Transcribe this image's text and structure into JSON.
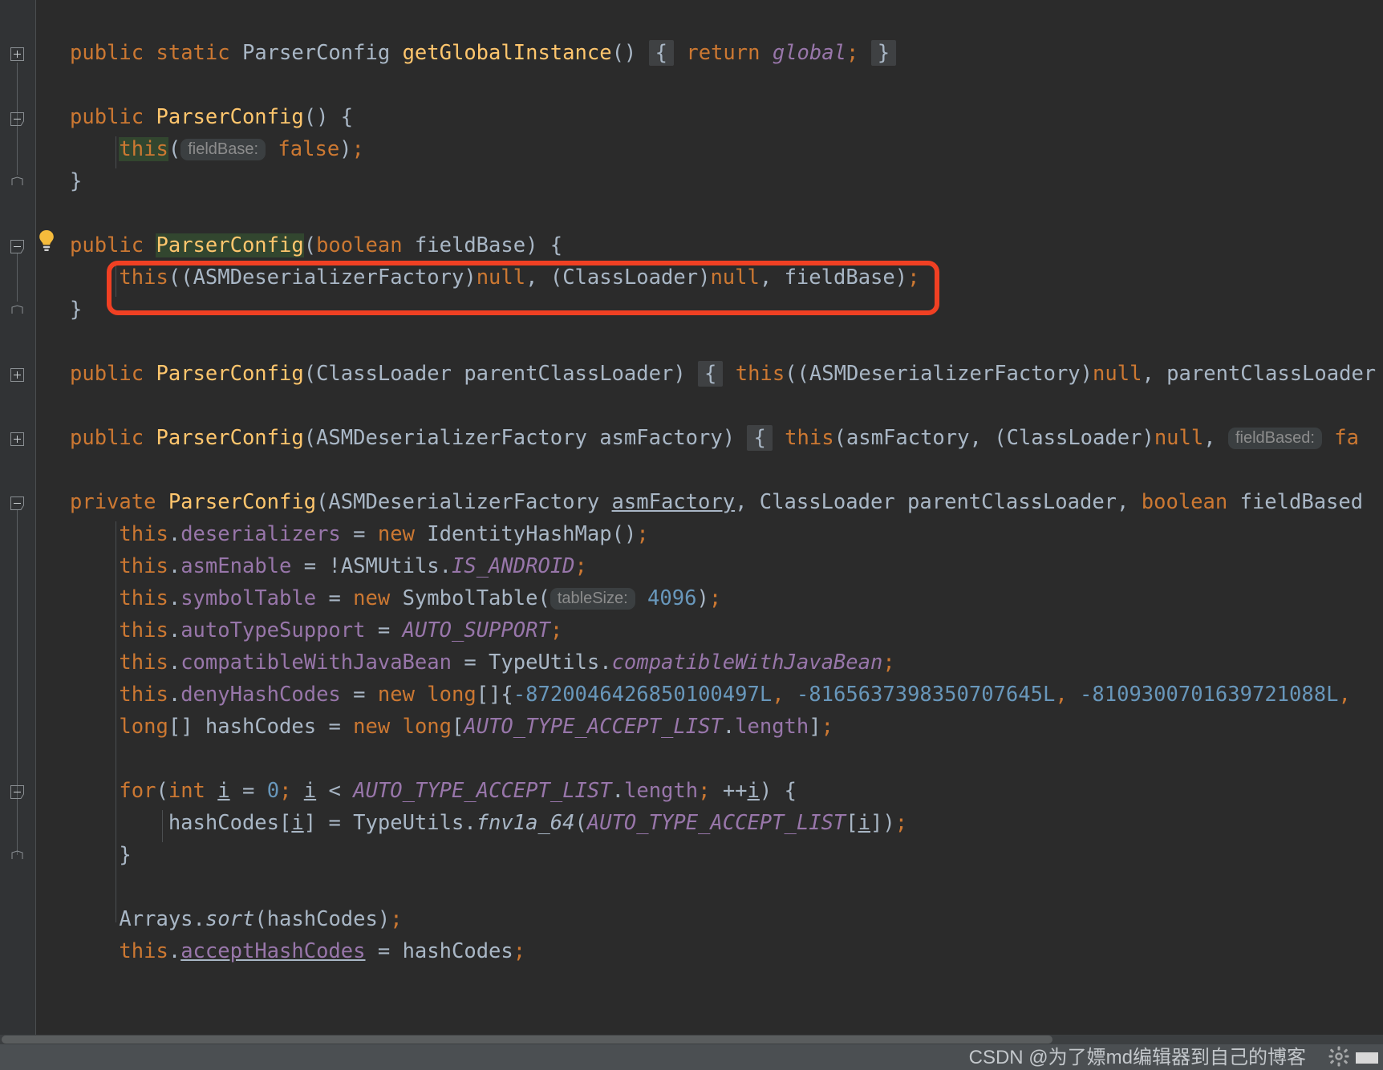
{
  "editor": {
    "background": "#2b2b2b",
    "gutter_background": "#313335",
    "annotation_color": "#f04023",
    "lines": [
      {
        "id": "line-get-global-instance",
        "indent": 0,
        "text": "public static ParserConfig getGlobalInstance() { return global; }"
      },
      {
        "id": "line-blank-1",
        "indent": 0,
        "text": ""
      },
      {
        "id": "line-ctor-noarg-sig",
        "indent": 0,
        "text": "public ParserConfig() {"
      },
      {
        "id": "line-ctor-noarg-body",
        "indent": 1,
        "text": "this( fieldBase: false);",
        "hint": "fieldBase:"
      },
      {
        "id": "line-ctor-noarg-close",
        "indent": 0,
        "text": "}"
      },
      {
        "id": "line-blank-2",
        "indent": 0,
        "text": ""
      },
      {
        "id": "line-ctor-boolean-sig",
        "indent": 0,
        "text": "public ParserConfig(boolean fieldBase) {"
      },
      {
        "id": "line-ctor-boolean-body",
        "indent": 1,
        "text": "this((ASMDeserializerFactory)null, (ClassLoader)null, fieldBase);",
        "annotated": true
      },
      {
        "id": "line-ctor-boolean-close",
        "indent": 0,
        "text": "}"
      },
      {
        "id": "line-blank-3",
        "indent": 0,
        "text": ""
      },
      {
        "id": "line-ctor-classloader",
        "indent": 0,
        "text": "public ParserConfig(ClassLoader parentClassLoader) { this((ASMDeserializerFactory)null, parentClassLoader"
      },
      {
        "id": "line-blank-4",
        "indent": 0,
        "text": ""
      },
      {
        "id": "line-ctor-asmfactory",
        "indent": 0,
        "text": "public ParserConfig(ASMDeserializerFactory asmFactory) { this(asmFactory, (ClassLoader)null,  fieldBased: fa",
        "hint": "fieldBased:"
      },
      {
        "id": "line-blank-5",
        "indent": 0,
        "text": ""
      },
      {
        "id": "line-ctor-private-sig",
        "indent": 0,
        "text": "private ParserConfig(ASMDeserializerFactory asmFactory, ClassLoader parentClassLoader, boolean fieldBased"
      },
      {
        "id": "line-deserializers",
        "indent": 1,
        "text": "this.deserializers = new IdentityHashMap();"
      },
      {
        "id": "line-asmenable",
        "indent": 1,
        "text": "this.asmEnable = !ASMUtils.IS_ANDROID;"
      },
      {
        "id": "line-symboltable",
        "indent": 1,
        "text": "this.symbolTable = new SymbolTable( tableSize: 4096);",
        "hint": "tableSize:"
      },
      {
        "id": "line-autotypesupport",
        "indent": 1,
        "text": "this.autoTypeSupport = AUTO_SUPPORT;"
      },
      {
        "id": "line-compatiblewithjavabean",
        "indent": 1,
        "text": "this.compatibleWithJavaBean = TypeUtils.compatibleWithJavaBean;"
      },
      {
        "id": "line-denyhashcodes",
        "indent": 1,
        "text": "this.denyHashCodes = new long[]{-8720046426850100497L, -8165637398350707645L, -8109300701639721088L,"
      },
      {
        "id": "line-hashcodes-decl",
        "indent": 1,
        "text": "long[] hashCodes = new long[AUTO_TYPE_ACCEPT_LIST.length];"
      },
      {
        "id": "line-blank-6",
        "indent": 0,
        "text": ""
      },
      {
        "id": "line-for-loop",
        "indent": 1,
        "text": "for(int i = 0; i < AUTO_TYPE_ACCEPT_LIST.length; ++i) {"
      },
      {
        "id": "line-for-body",
        "indent": 2,
        "text": "hashCodes[i] = TypeUtils.fnv1a_64(AUTO_TYPE_ACCEPT_LIST[i]);"
      },
      {
        "id": "line-for-close",
        "indent": 1,
        "text": "}"
      },
      {
        "id": "line-blank-7",
        "indent": 0,
        "text": ""
      },
      {
        "id": "line-arrays-sort",
        "indent": 1,
        "text": "Arrays.sort(hashCodes);"
      },
      {
        "id": "line-accept-hashcodes",
        "indent": 1,
        "text": "this.acceptHashCodes = hashCodes;"
      }
    ],
    "gutter_icons": [
      {
        "name": "fold-expand-icon",
        "glyph": "+"
      },
      {
        "name": "fold-collapse-icon",
        "glyph": "-"
      },
      {
        "name": "fold-end-icon",
        "glyph": "end"
      },
      {
        "name": "intention-bulb-icon",
        "glyph": "bulb"
      }
    ]
  },
  "statusbar": {
    "watermark": "CSDN @为了嫖md编辑器到自己的博客",
    "gear_icon": "gear-icon"
  }
}
